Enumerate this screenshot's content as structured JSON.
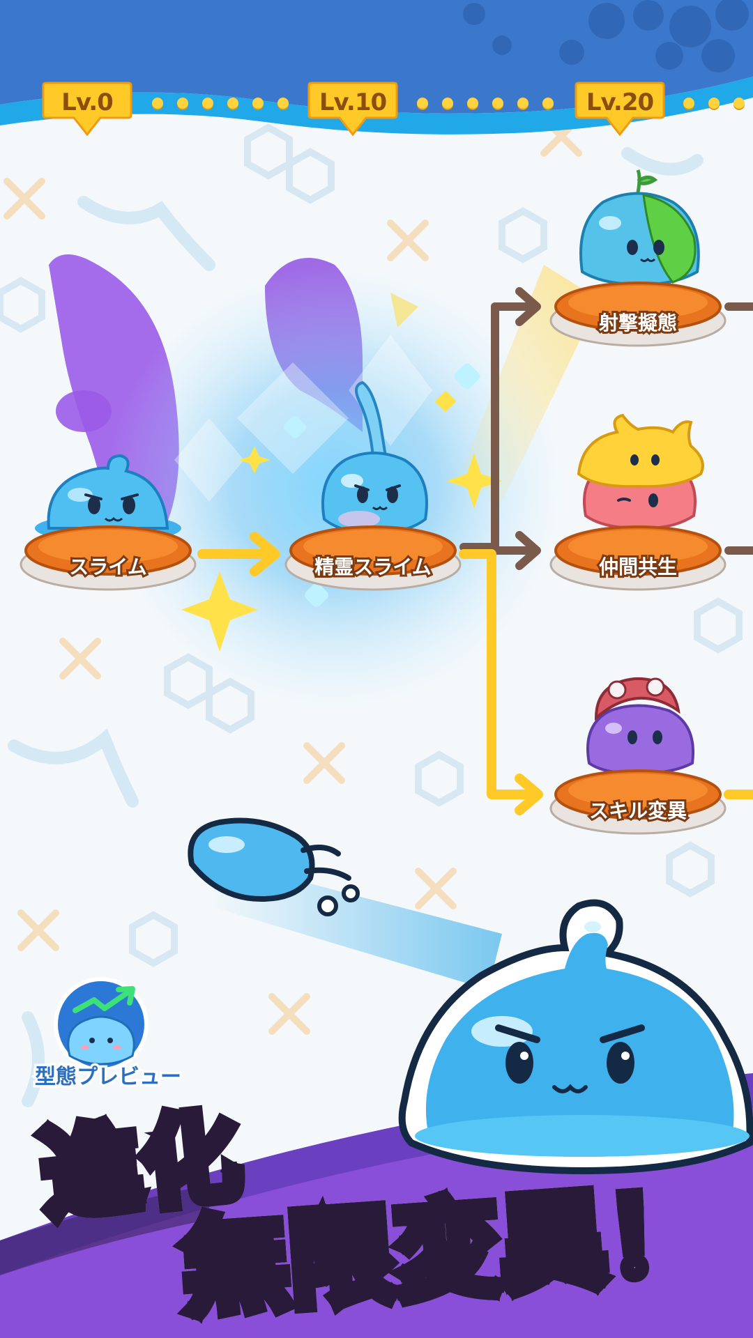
{
  "levels": [
    {
      "label": "Lv.0"
    },
    {
      "label": "Lv.10"
    },
    {
      "label": "Lv.20"
    }
  ],
  "evolution_nodes": {
    "base": {
      "label": "スライム"
    },
    "spirit": {
      "label": "精霊スライム"
    },
    "shooter": {
      "label": "射撃擬態"
    },
    "companion": {
      "label": "仲間共生"
    },
    "skill": {
      "label": "スキル変異"
    }
  },
  "preview_button": {
    "label": "型態プレビュー",
    "icon": "slime-growth-icon"
  },
  "headline": {
    "line1": "進化",
    "line2": "無限変異！"
  },
  "colors": {
    "top_band": "#3b78cc",
    "accent_blue": "#20a8e8",
    "badge_gold": "#ffc928",
    "pedestal_orange": "#e8741f",
    "arrow_yellow": "#ffc928",
    "arrow_brown": "#7a5a4a",
    "headline_purple": "#8a4fd8"
  }
}
